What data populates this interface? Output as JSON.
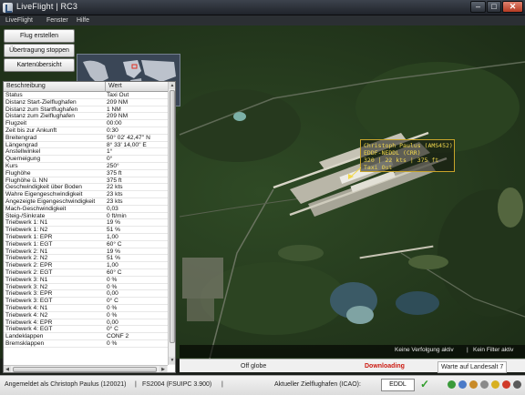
{
  "window": {
    "title": "LiveFlight | RC3",
    "min_glyph": "–",
    "max_glyph": "□",
    "close_glyph": "✕"
  },
  "menu": [
    "LiveFlight",
    "Fenster",
    "Hilfe"
  ],
  "side_buttons": {
    "create_flight": "Flug erstellen",
    "stop_transfer": "Übertragung stoppen",
    "map_overview": "Kartenübersicht"
  },
  "table": {
    "headers": {
      "description": "Beschreibung",
      "value": "Wert"
    },
    "rows": [
      {
        "label": "Status",
        "value": "Taxi Out"
      },
      {
        "label": "Distanz Start-Zielflughafen",
        "value": "209 NM"
      },
      {
        "label": "Distanz zum Startflughafen",
        "value": "1 NM"
      },
      {
        "label": "Distanz zum Zielflughafen",
        "value": "209 NM"
      },
      {
        "label": "Flugzeit",
        "value": "00:00"
      },
      {
        "label": "Zeit bis zur Ankunft",
        "value": "0:30"
      },
      {
        "label": "Breitengrad",
        "value": "50° 02' 42,47'' N"
      },
      {
        "label": "Längengrad",
        "value": "8° 33' 14,00'' E"
      },
      {
        "label": "Anstellwinkel",
        "value": "1°"
      },
      {
        "label": "Querneigung",
        "value": "0°"
      },
      {
        "label": "Kurs",
        "value": "250°"
      },
      {
        "label": "Flughöhe",
        "value": "375 ft"
      },
      {
        "label": "Flughöhe ü. NN",
        "value": "375 ft"
      },
      {
        "label": "Geschwindigkeit über Boden",
        "value": "22 kts"
      },
      {
        "label": "Wahre Eigengeschwindigkeit",
        "value": "23 kts"
      },
      {
        "label": "Angezeigte Eigengeschwindigkeit",
        "value": "23 kts"
      },
      {
        "label": "Mach-Geschwindigkeit",
        "value": "0,03"
      },
      {
        "label": "Steig-/Sinkrate",
        "value": "0 ft/min"
      },
      {
        "label": "Triebwerk 1: N1",
        "value": "19 %"
      },
      {
        "label": "Triebwerk 1: N2",
        "value": "51 %"
      },
      {
        "label": "Triebwerk 1: EPR",
        "value": "1,00"
      },
      {
        "label": "Triebwerk 1: EGT",
        "value": "60° C"
      },
      {
        "label": "Triebwerk 2: N1",
        "value": "19 %"
      },
      {
        "label": "Triebwerk 2: N2",
        "value": "51 %"
      },
      {
        "label": "Triebwerk 2: EPR",
        "value": "1,00"
      },
      {
        "label": "Triebwerk 2: EGT",
        "value": "60° C"
      },
      {
        "label": "Triebwerk 3: N1",
        "value": "0 %"
      },
      {
        "label": "Triebwerk 3: N2",
        "value": "0 %"
      },
      {
        "label": "Triebwerk 3: EPR",
        "value": "0,00"
      },
      {
        "label": "Triebwerk 3: EGT",
        "value": "0° C"
      },
      {
        "label": "Triebwerk 4: N1",
        "value": "0 %"
      },
      {
        "label": "Triebwerk 4: N2",
        "value": "0 %"
      },
      {
        "label": "Triebwerk 4: EPR",
        "value": "0,00"
      },
      {
        "label": "Triebwerk 4: EGT",
        "value": "0° C"
      },
      {
        "label": "Landeklappen",
        "value": "CONF 2"
      },
      {
        "label": "Bremsklappen",
        "value": "0 %"
      }
    ],
    "scroll_up": "▲",
    "scroll_down": "▼",
    "scroll_left": "◀",
    "scroll_right": "▶"
  },
  "flight_label": {
    "line1": "Christoph Paulus (AMS452)",
    "line2": "EDDF-NEDDL (CRR)",
    "line3": "320 | 22 kts | 375 ft",
    "line4": "Taxi Out"
  },
  "map_status": {
    "tracking": "Keine Verfolgung aktiv",
    "separator": "|",
    "filter": "Kein Filter aktiv"
  },
  "tabs": {
    "google_earth": "Off globe",
    "downloading": "Downloading",
    "ready": "Warte auf Landesalt 7"
  },
  "status_bar": {
    "login": "Angemeldet als Christoph Paulus (120021)",
    "sim": "FS2004 (FSUIPC 3.900)",
    "sep1": "|",
    "sep2": "|",
    "icao_label": "Aktueller Zielflughafen (ICAO):",
    "icao_value": "EDDL",
    "check": "✓"
  },
  "colors": {
    "accent_label": "#f2d84d",
    "downloading": "#cc1a10",
    "check_green": "#2f9d2a"
  }
}
